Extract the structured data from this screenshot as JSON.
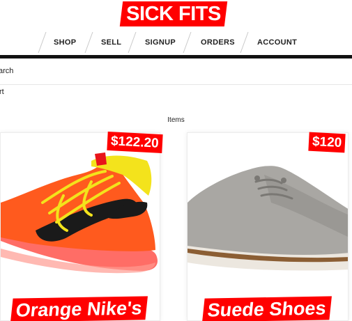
{
  "brand": {
    "logo_text": "SICK FITS",
    "accent": "#ff0000"
  },
  "nav": {
    "items": [
      "SHOP",
      "SELL",
      "SIGNUP",
      "ORDERS",
      "ACCOUNT"
    ]
  },
  "search": {
    "label": "arch"
  },
  "cart": {
    "label": "rt"
  },
  "main": {
    "heading": "Items",
    "products": [
      {
        "price": "$122.20",
        "title": "Orange Nike's",
        "image_icon": "sneaker-icon"
      },
      {
        "price": "$120",
        "title": "Suede Shoes",
        "image_icon": "shoe-icon"
      }
    ]
  }
}
